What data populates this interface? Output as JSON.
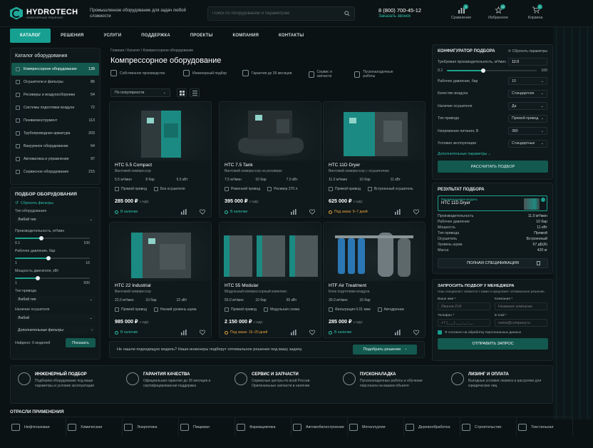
{
  "brand": {
    "name": "HYDROTECH",
    "tagline": "инженерные решения",
    "slogan": "Промышленное оборудование для задач любой сложности"
  },
  "search": {
    "placeholder": "Поиск по оборудованию и параметрам"
  },
  "contacts": {
    "phone": "8 (800) 700-45-12",
    "callback": "Заказать звонок"
  },
  "header_actions": [
    {
      "label": "Сравнение",
      "count": "3"
    },
    {
      "label": "Избранное",
      "count": "12"
    },
    {
      "label": "Корзина",
      "count": "0"
    }
  ],
  "nav": [
    "Каталог",
    "Решения",
    "Услуги",
    "Поддержка",
    "Проекты",
    "Компания",
    "Контакты"
  ],
  "catalog": {
    "title": "Каталог оборудования",
    "items": [
      {
        "label": "Компрессорное оборудование",
        "count": "128"
      },
      {
        "label": "Осушители и фильтры",
        "count": "86"
      },
      {
        "label": "Ресиверы и воздухосборники",
        "count": "54"
      },
      {
        "label": "Системы подготовки воздуха",
        "count": "72"
      },
      {
        "label": "Пневмоинструмент",
        "count": "113"
      },
      {
        "label": "Трубопроводная арматура",
        "count": "203"
      },
      {
        "label": "Вакуумное оборудование",
        "count": "64"
      },
      {
        "label": "Автоматика и управление",
        "count": "97"
      },
      {
        "label": "Сервисное оборудование",
        "count": "215"
      }
    ]
  },
  "filter": {
    "title": "Подбор оборудования",
    "reset": "Сбросить фильтры",
    "type_label": "Тип оборудования",
    "type_value": "Любой тип",
    "perf_label": "Производительность, м³/мин",
    "perf_min": "0.1",
    "perf_max": "100",
    "perf_level": 0.35,
    "pressure_label": "Рабочее давление, бар",
    "pressure_min": "1",
    "pressure_max": "16",
    "pressure_level": 0.45,
    "power_label": "Мощность двигателя, кВт",
    "power_min": "1",
    "power_max": "500",
    "power_level": 0.3,
    "drive_label": "Тип привода",
    "drive_value": "Любой тип",
    "dryer_label": "Наличие осушителя",
    "dryer_value": "Любой",
    "extra": "Дополнительные фильтры",
    "found": "Найдено: 6 моделей",
    "show": "Показать"
  },
  "breadcrumb": "Главная / Каталог / Компрессорное оборудование",
  "page_title": "Компрессорное оборудование",
  "features": [
    "Собственное производство",
    "Инженерный подбор",
    "Гарантия до 36 месяцев",
    "Сервис и запчасти",
    "Пусконаладочные работы"
  ],
  "sort": "По популярности",
  "products": [
    {
      "name": "HTC 5.5 Compact",
      "type": "Винтовой компрессор",
      "specs": [
        "5.5 м³/мин",
        "8 бар",
        "5.5 кВт"
      ],
      "opts": [
        "Прямой привод",
        "Без осушителя"
      ],
      "price": "285 000 ₽",
      "vat": "с НДС",
      "stock": "В наличии",
      "status": "in"
    },
    {
      "name": "HTC 7.5 Tank",
      "type": "Винтовой компрессор на ресивере",
      "specs": [
        "7.5 м³/мин",
        "10 бар",
        "7.5 кВт"
      ],
      "opts": [
        "Ременной привод",
        "Ресивер 270 л"
      ],
      "price": "395 000 ₽",
      "vat": "с НДС",
      "stock": "В наличии",
      "status": "in"
    },
    {
      "name": "HTC 11D Dryer",
      "type": "Винтовой компрессор с осушителем",
      "specs": [
        "11.0 м³/мин",
        "10 бар",
        "11 кВт"
      ],
      "opts": [
        "Прямой привод",
        "Встроенный осушитель"
      ],
      "price": "625 000 ₽",
      "vat": "с НДС",
      "stock": "Под заказ: 5–7 дней",
      "status": "order"
    },
    {
      "name": "HTC 22 Industrial",
      "type": "Винтовой компрессор",
      "specs": [
        "22.0 м³/мин",
        "10 бар",
        "22 кВт"
      ],
      "opts": [
        "Прямой привод",
        "Низкий уровень шума"
      ],
      "price": "985 000 ₽",
      "vat": "с НДС",
      "stock": "В наличии",
      "status": "in"
    },
    {
      "name": "HTC 55 Modular",
      "type": "Модульный компрессорный комплекс",
      "specs": [
        "55.0 м³/мин",
        "10 бар",
        "55 кВт"
      ],
      "opts": [
        "Прямой привод",
        "Модульная схема"
      ],
      "price": "2 150 000 ₽",
      "vat": "с НДС",
      "stock": "Под заказ: 15–20 дней",
      "status": "order"
    },
    {
      "name": "HTF Air Treatment",
      "type": "Блок подготовки воздуха",
      "specs": [
        "30.0 м³/мин",
        "16 бар",
        ""
      ],
      "opts": [
        "Фильтрация 0.01 мкм",
        "Автодренаж"
      ],
      "price": "285 000 ₽",
      "vat": "с НДС",
      "stock": "В наличии",
      "status": "in"
    }
  ],
  "notfound": {
    "text": "Не нашли подходящую модель? Наши инженеры подберут оптимальное решение под вашу задачу.",
    "button": "Подобрать решение"
  },
  "configurator": {
    "title": "Конфигуратор подбора",
    "reset": "Сбросить параметры",
    "perf_label": "Требуемая производительность, м³/мин",
    "perf_value": "12.0",
    "perf_min": "0.1",
    "perf_max": "100",
    "perf_level": 0.4,
    "rows": [
      {
        "label": "Рабочее давление, бар",
        "value": "10"
      },
      {
        "label": "Качество воздуха",
        "value": "Стандартное"
      },
      {
        "label": "Наличие осушителя",
        "value": "Да"
      },
      {
        "label": "Тип привода",
        "value": "Прямой привод"
      },
      {
        "label": "Напряжение питания, В",
        "value": "380"
      },
      {
        "label": "Условия эксплуатации",
        "value": "Стандартные"
      }
    ],
    "extra": "Дополнительные параметры",
    "button": "Рассчитать подбор"
  },
  "result": {
    "title": "Результат подбора",
    "tag": "Рекомендуемая модель",
    "model": "HTC 11D Dryer",
    "rows": [
      {
        "label": "Производительность",
        "value": "11.0 м³/мин"
      },
      {
        "label": "Рабочее давление",
        "value": "10 бар"
      },
      {
        "label": "Мощность",
        "value": "11 кВт"
      },
      {
        "label": "Тип привода",
        "value": "Прямой"
      },
      {
        "label": "Осушитель",
        "value": "Встроенный"
      },
      {
        "label": "Уровень шума",
        "value": "67 дБ(А)"
      },
      {
        "label": "Масса",
        "value": "420 кг"
      }
    ],
    "button": "Полная спецификация"
  },
  "request": {
    "title": "Запросить подбор у менеджера",
    "subtitle": "Наш специалист свяжется с вами и предложит оптимальное решение.",
    "name_label": "Ваше имя *",
    "name_ph": "Иванов И.И.",
    "company_label": "Компания *",
    "company_ph": "Название компании",
    "phone_label": "Телефон *",
    "phone_ph": "+7 (___) ___-__-__",
    "email_label": "E-mail *",
    "email_ph": "name@company.ru",
    "consent": "Я согласен на обработку персональных данных",
    "button": "Отправить запрос"
  },
  "benefits": [
    {
      "title": "Инженерный подбор",
      "text": "Подберём оборудование под ваши параметры и условия эксплуатации"
    },
    {
      "title": "Гарантия качества",
      "text": "Официальная гарантия до 36 месяцев и сертифицированная поддержка"
    },
    {
      "title": "Сервис и запчасти",
      "text": "Сервисные центры по всей России. Оригинальные запчасти в наличии"
    },
    {
      "title": "Пусконаладка",
      "text": "Пусконаладочные работы и обучение персонала на вашем объекте"
    },
    {
      "title": "Лизинг и оплата",
      "text": "Выгодные условия лизинга и рассрочки для юридических лиц"
    }
  ],
  "industries_title": "Отрасли применения",
  "industries": [
    "Нефтегазовая",
    "Химическая",
    "Энергетика",
    "Пищевая",
    "Фармацевтика",
    "Автомобилестроение",
    "Металлургия",
    "Деревообработка",
    "Строительство",
    "Текстильная"
  ],
  "colors": {
    "accent": "#17a091",
    "bg": "#0b1214",
    "warn": "#e8a23d"
  }
}
